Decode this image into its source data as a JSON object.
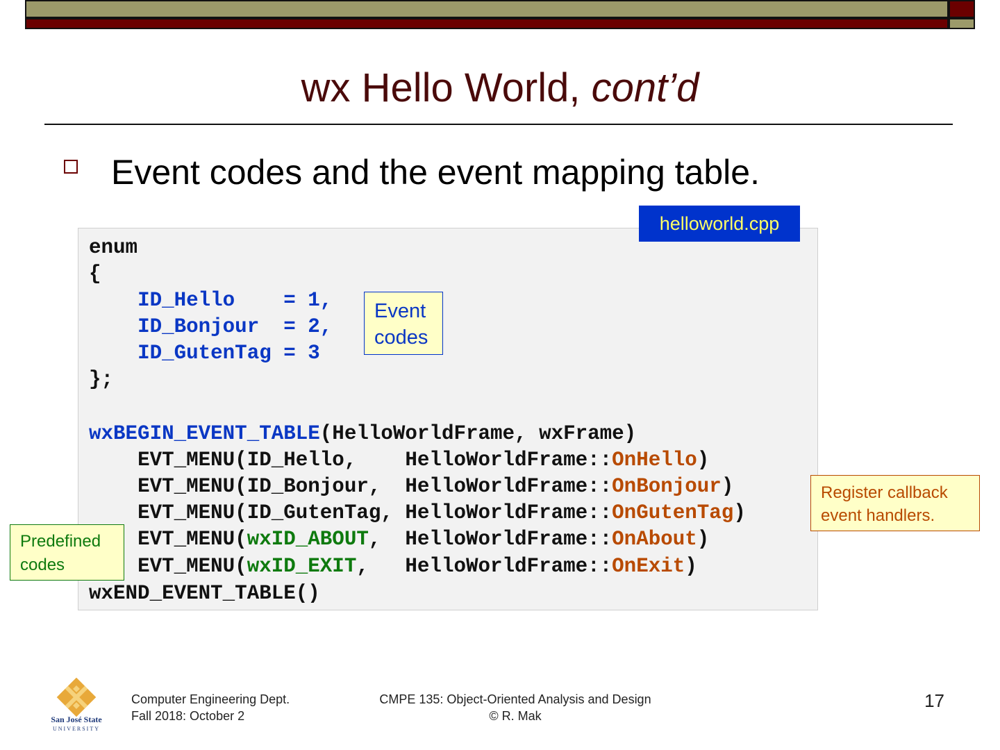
{
  "slide": {
    "title_main": "wx Hello World, ",
    "title_italic": "cont’d",
    "bullet": "Event codes and the event mapping table.",
    "file_tag": "helloworld.cpp"
  },
  "code": {
    "l1": "enum",
    "l2": "{",
    "l3_indent": "    ",
    "l3": "ID_Hello    = 1,",
    "l4": "ID_Bonjour  = 2,",
    "l5": "ID_GutenTag = 3",
    "l6": "};",
    "l8_macro": "wxBEGIN_EVENT_TABLE",
    "l8_rest": "(HelloWorldFrame, wxFrame)",
    "evt_prefix": "EVT_MENU(",
    "l9_id": "ID_Hello,    ",
    "l10_id": "ID_Bonjour,  ",
    "l11_id": "ID_GutenTag, ",
    "l12_id": "wxID_ABOUT",
    "l12_sep": ",  ",
    "l13_id": "wxID_EXIT",
    "l13_sep": ",   ",
    "frame_scope": "HelloWorldFrame::",
    "h1": "OnHello",
    "h2": "OnBonjour",
    "h3": "OnGutenTag",
    "h4": "OnAbout",
    "h5": "OnExit",
    "close_paren": ")",
    "l14": "wxEND_EVENT_TABLE()"
  },
  "annotations": {
    "event_codes_1": "Event",
    "event_codes_2": "codes",
    "register_1": "Register callback",
    "register_2": "event handlers.",
    "predefined_1": "Predefined",
    "predefined_2": "codes"
  },
  "footer": {
    "logo_text_1": "San José State",
    "logo_text_2": "UNIVERSITY",
    "dept": "Computer Engineering Dept.",
    "date": "Fall 2018: October 2",
    "course": "CMPE 135: Object-Oriented Analysis and Design",
    "author": "© R. Mak",
    "page": "17"
  },
  "colors": {
    "title": "#4a0a0a",
    "code_blue": "#0a37c4",
    "code_green": "#0e7a0e",
    "code_orange": "#b84a00",
    "tag_bg": "#0033cc",
    "tag_text": "#ffff66"
  }
}
